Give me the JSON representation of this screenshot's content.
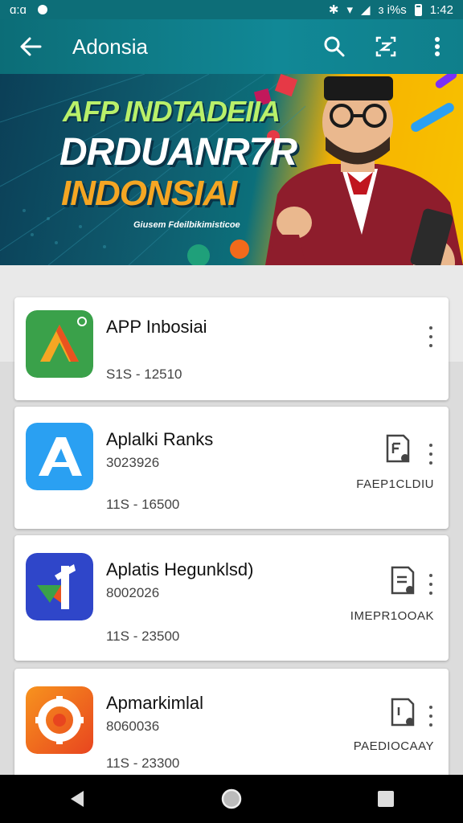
{
  "status_bar": {
    "left_text": "ɑ:ɑ",
    "signal_text": "ɜ i%s",
    "time": "1:42"
  },
  "app_bar": {
    "title": "Adonsia",
    "icons": [
      "back-arrow-icon",
      "search-icon",
      "scan-icon",
      "more-vert-icon"
    ]
  },
  "banner": {
    "line1": "AFP INDTADEIIA",
    "line2": "DRDUANR7R",
    "line3": "INDONSIAI",
    "line4": "Giusem Fdeilbikimisticoe"
  },
  "apps": [
    {
      "name": "APP Inbosiai",
      "sub": "",
      "size": "S1S - 12510",
      "action": "",
      "icon": "green-triangle-app-icon",
      "icon_color": "#3aa14a"
    },
    {
      "name": "Aplalki Ranks",
      "sub": "3023926",
      "size": "11S - 16500",
      "action": "FAEP1CLDIU",
      "icon": "blue-a-app-icon",
      "icon_color": "#2aa0f2"
    },
    {
      "name": "Aplatis Hegunklsd)",
      "sub": "8002026",
      "size": "11S - 23500",
      "action": "IMEPR1OOAK",
      "icon": "navy-flag-app-icon",
      "icon_color": "#2f46c9"
    },
    {
      "name": "Apmarkimlal",
      "sub": "8060036",
      "size": "11S - 23300",
      "action": "PAEDIOCAAY",
      "icon": "orange-gear-app-icon",
      "icon_color": "#f26a1b"
    }
  ]
}
